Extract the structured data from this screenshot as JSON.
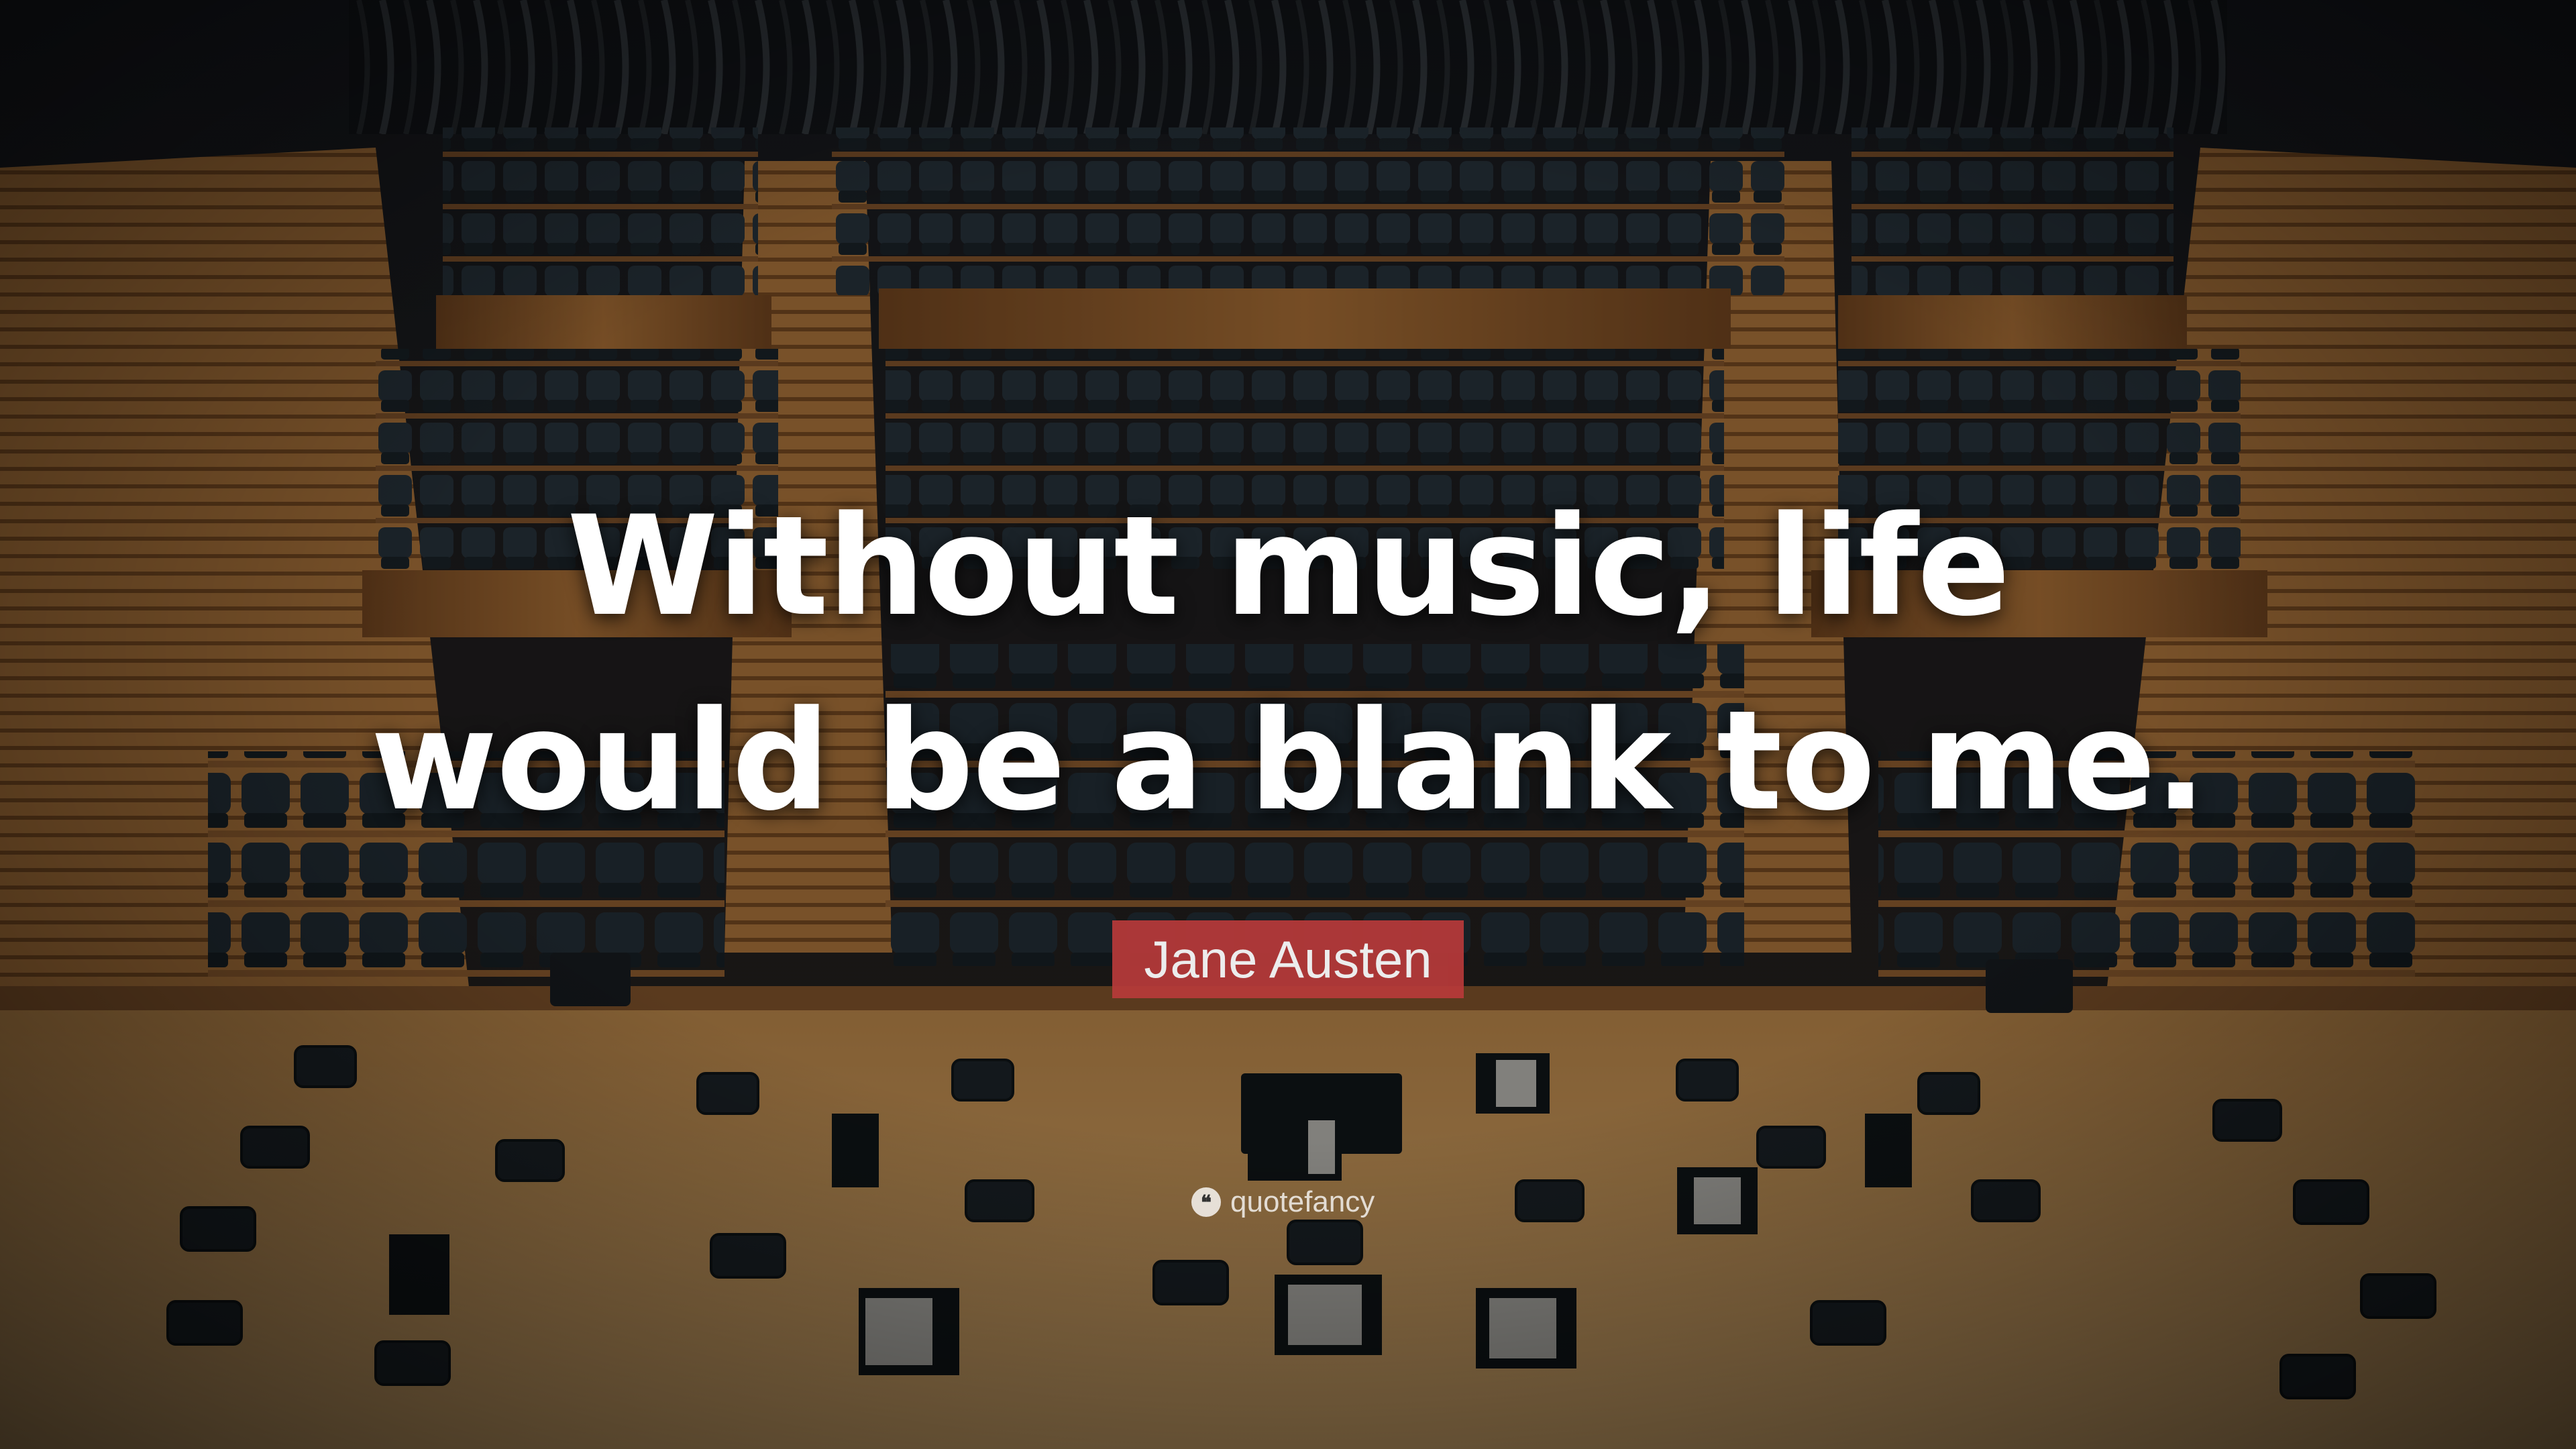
{
  "quote": {
    "lines": [
      "Without music, life",
      "would be a blank to me."
    ]
  },
  "author": "Jane Austen",
  "watermark": {
    "text": "quotefancy",
    "icon": "quote-marks-icon"
  },
  "colors": {
    "author_badge": "#b83a3a",
    "quote_text": "#ffffff",
    "wood": "#b5773a",
    "seat": "#2a3640"
  }
}
